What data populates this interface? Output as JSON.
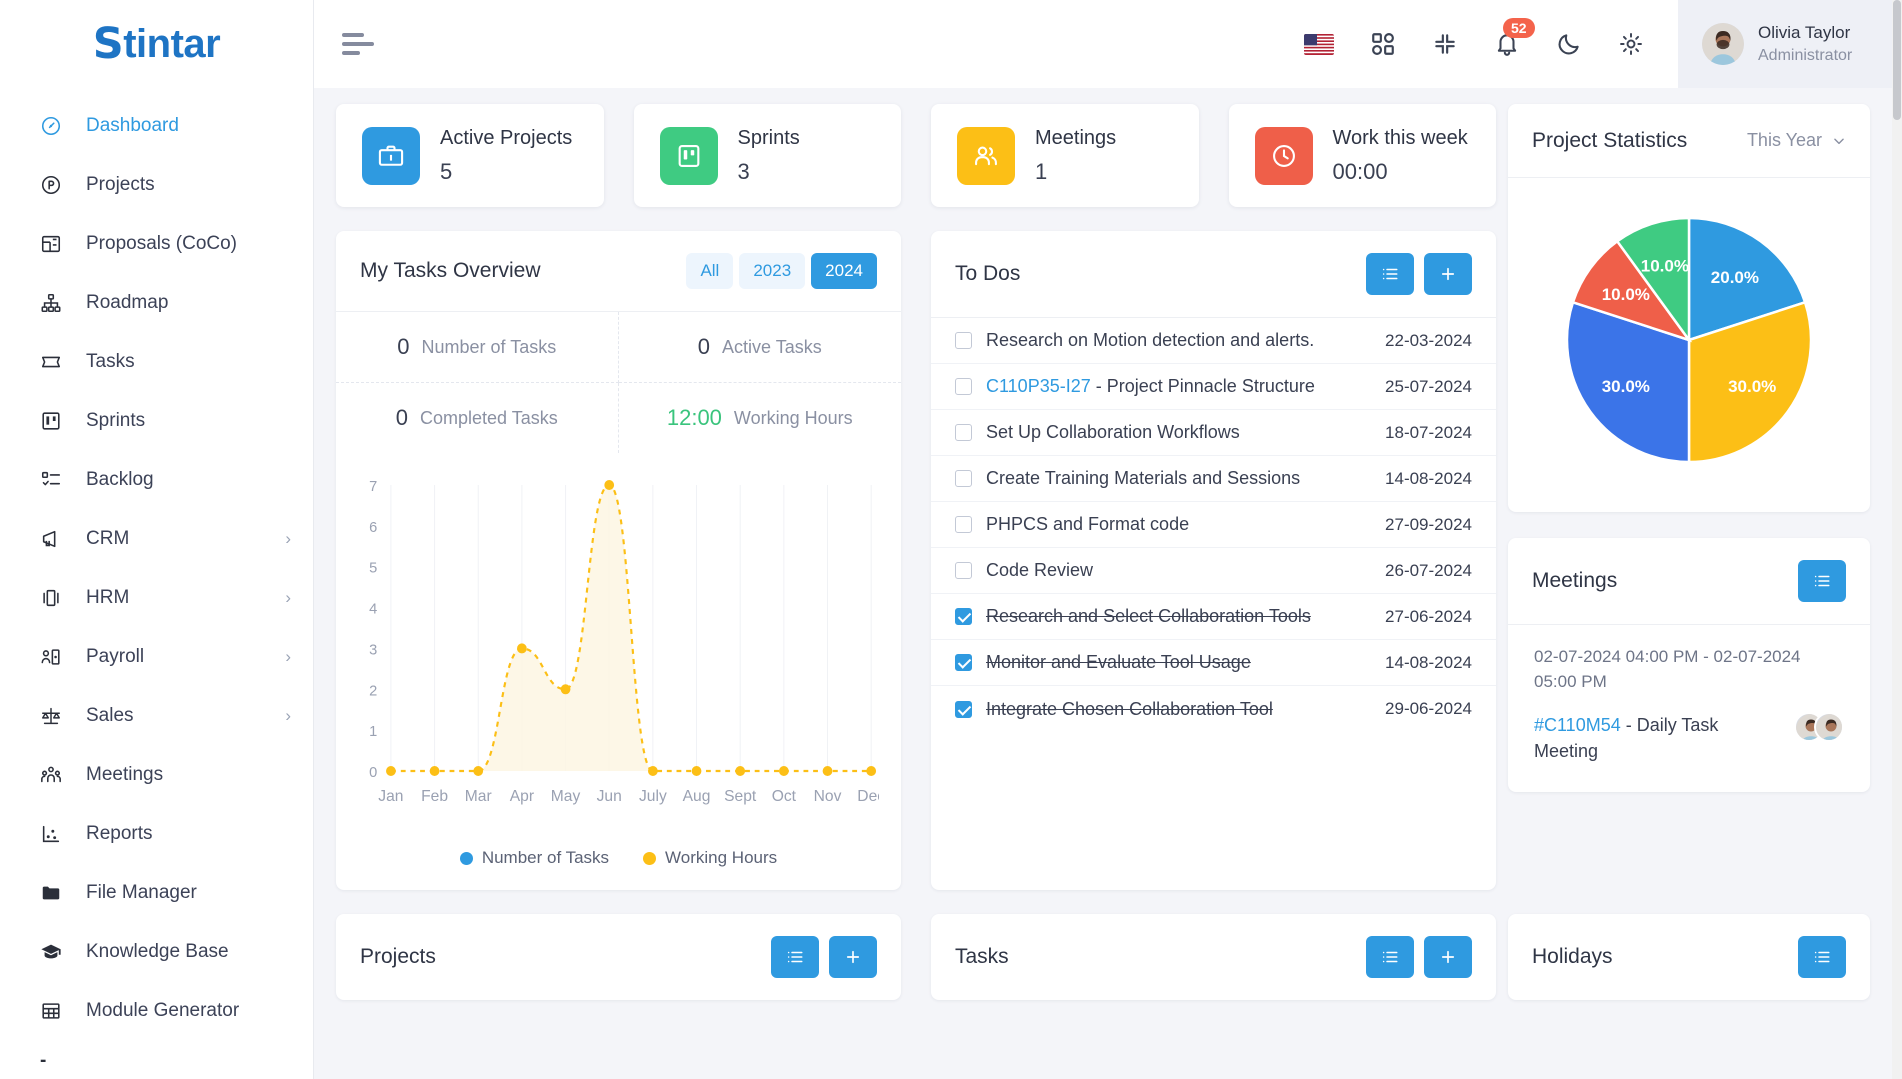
{
  "brand": {
    "name_s": "S",
    "name_rest": "tintar",
    "accent": "#1e74c4"
  },
  "sidebar": {
    "items": [
      {
        "label": "Dashboard",
        "icon": "speedometer-icon",
        "active": true,
        "expandable": false
      },
      {
        "label": "Projects",
        "icon": "circle-p-icon",
        "active": false,
        "expandable": false
      },
      {
        "label": "Proposals (CoCo)",
        "icon": "layout-icon",
        "active": false,
        "expandable": false
      },
      {
        "label": "Roadmap",
        "icon": "sitemap-icon",
        "active": false,
        "expandable": false
      },
      {
        "label": "Tasks",
        "icon": "ticket-icon",
        "active": false,
        "expandable": false
      },
      {
        "label": "Sprints",
        "icon": "board-icon",
        "active": false,
        "expandable": false
      },
      {
        "label": "Backlog",
        "icon": "checklist-icon",
        "active": false,
        "expandable": false
      },
      {
        "label": "CRM",
        "icon": "megaphone-icon",
        "active": false,
        "expandable": true
      },
      {
        "label": "HRM",
        "icon": "presentation-icon",
        "active": false,
        "expandable": true
      },
      {
        "label": "Payroll",
        "icon": "user-card-icon",
        "active": false,
        "expandable": true
      },
      {
        "label": "Sales",
        "icon": "scales-icon",
        "active": false,
        "expandable": true
      },
      {
        "label": "Meetings",
        "icon": "people-icon",
        "active": false,
        "expandable": false
      },
      {
        "label": "Reports",
        "icon": "scatter-chart-icon",
        "active": false,
        "expandable": false
      },
      {
        "label": "File Manager",
        "icon": "folder-icon",
        "active": false,
        "expandable": false
      },
      {
        "label": "Knowledge Base",
        "icon": "graduation-cap-icon",
        "active": false,
        "expandable": false
      },
      {
        "label": "Module Generator",
        "icon": "table-grid-icon",
        "active": false,
        "expandable": false
      }
    ],
    "tail_label": "-"
  },
  "topbar": {
    "menu_icon": "hamburger-icon",
    "language_flag": "us-flag-icon",
    "apps_icon": "grid-apps-icon",
    "fullscreen_icon": "compress-icon",
    "notifications_icon": "bell-icon",
    "notifications_count": "52",
    "theme_icon": "moon-icon",
    "settings_icon": "gear-icon",
    "profile": {
      "name": "Olivia Taylor",
      "role": "Administrator"
    }
  },
  "stats": [
    {
      "title": "Active Projects",
      "value": "5",
      "icon": "briefcase-icon",
      "color": "#2f9ae0"
    },
    {
      "title": "Sprints",
      "value": "3",
      "icon": "board-icon",
      "color": "#3fcb82"
    },
    {
      "title": "Meetings",
      "value": "1",
      "icon": "people-icon",
      "color": "#fcbf16"
    },
    {
      "title": "Work this week",
      "value": "00:00",
      "icon": "clock-icon",
      "color": "#ef5f49"
    }
  ],
  "tasks_overview": {
    "title": "My Tasks Overview",
    "filters": [
      {
        "label": "All",
        "active": false
      },
      {
        "label": "2023",
        "active": false
      },
      {
        "label": "2024",
        "active": true
      }
    ],
    "cells": [
      {
        "value": "0",
        "label": "Number of Tasks",
        "green": false
      },
      {
        "value": "0",
        "label": "Active Tasks",
        "green": false
      },
      {
        "value": "0",
        "label": "Completed Tasks",
        "green": false
      },
      {
        "value": "12:00",
        "label": "Working Hours",
        "green": true
      }
    ]
  },
  "chart_data": {
    "type": "area",
    "title": "My Tasks Overview",
    "xlabel": "",
    "ylabel": "",
    "ylim": [
      0,
      7
    ],
    "yticks": [
      "0",
      "1",
      "2",
      "3",
      "4",
      "5",
      "6",
      "7"
    ],
    "categories": [
      "Jan",
      "Feb",
      "Mar",
      "Apr",
      "May",
      "Jun",
      "July",
      "Aug",
      "Sept",
      "Oct",
      "Nov",
      "Dec"
    ],
    "grid": true,
    "legend_position": "bottom",
    "series": [
      {
        "name": "Number of Tasks",
        "color": "#2f9ae0",
        "values": [
          0,
          0,
          0,
          0,
          0,
          0,
          0,
          0,
          0,
          0,
          0,
          0
        ]
      },
      {
        "name": "Working Hours",
        "color": "#fcbf16",
        "values": [
          0,
          0,
          0,
          3,
          2,
          7,
          0,
          0,
          0,
          0,
          0,
          0
        ]
      }
    ]
  },
  "todos": {
    "title": "To Dos",
    "list_icon": "list-icon",
    "add_icon": "plus-icon",
    "items": [
      {
        "code": "",
        "text": "Research on Motion detection and alerts.",
        "date": "22-03-2024",
        "done": false
      },
      {
        "code": "C110P35-I27",
        "text": " - Project Pinnacle Structure",
        "date": "25-07-2024",
        "done": false
      },
      {
        "code": "",
        "text": "Set Up Collaboration Workflows",
        "date": "18-07-2024",
        "done": false
      },
      {
        "code": "",
        "text": "Create Training Materials and Sessions",
        "date": "14-08-2024",
        "done": false
      },
      {
        "code": "",
        "text": "PHPCS and Format code",
        "date": "27-09-2024",
        "done": false
      },
      {
        "code": "",
        "text": "Code Review",
        "date": "26-07-2024",
        "done": false
      },
      {
        "code": "",
        "text": "Research and Select Collaboration Tools",
        "date": "27-06-2024",
        "done": true
      },
      {
        "code": "",
        "text": "Monitor and Evaluate Tool Usage",
        "date": "14-08-2024",
        "done": true
      },
      {
        "code": "",
        "text": "Integrate Chosen Collaboration Tool",
        "date": "29-06-2024",
        "done": true
      }
    ]
  },
  "project_statistics": {
    "title": "Project Statistics",
    "range_label": "This Year",
    "chevron_icon": "chevron-down-icon",
    "chart": {
      "type": "pie",
      "labels": [
        "20.0%",
        "30.0%",
        "30.0%",
        "10.0%",
        "10.0%"
      ],
      "values": [
        20.0,
        30.0,
        30.0,
        10.0,
        10.0
      ],
      "colors": [
        "#2f9ae0",
        "#fcbf16",
        "#3b74e8",
        "#ef5f49",
        "#3fcb82"
      ]
    }
  },
  "meetings_panel": {
    "title": "Meetings",
    "list_icon": "list-icon",
    "time_range": "02-07-2024 04:00 PM - 02-07-2024 05:00 PM",
    "code": "#C110M54",
    "name": " - Daily Task Meeting"
  },
  "bottom_panels": [
    {
      "title": "Projects",
      "buttons": [
        "list-icon",
        "plus-icon"
      ]
    },
    {
      "title": "Tasks",
      "buttons": [
        "list-icon",
        "plus-icon"
      ]
    },
    {
      "title": "Holidays",
      "buttons": [
        "list-icon"
      ]
    }
  ]
}
